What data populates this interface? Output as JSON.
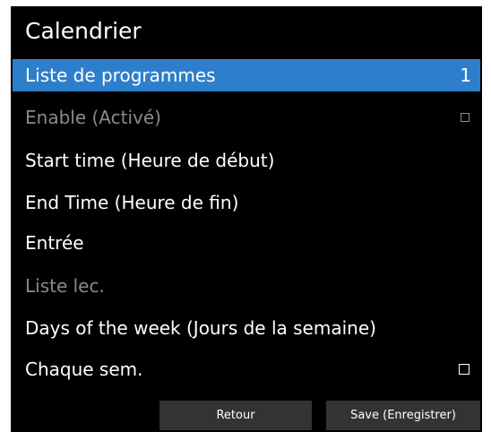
{
  "title": "Calendrier",
  "menu": {
    "items": [
      {
        "label": "Liste de programmes",
        "value": "1"
      },
      {
        "label": "Enable (Activé)",
        "checked": false
      },
      {
        "label": "Start time (Heure de début)"
      },
      {
        "label": "End Time (Heure de fin)"
      },
      {
        "label": "Entrée"
      },
      {
        "label": "Liste lec."
      },
      {
        "label": "Days of the week (Jours de la semaine)"
      },
      {
        "label": "Chaque sem.",
        "checked": false
      }
    ]
  },
  "footer": {
    "back_label": "Retour",
    "save_label": "Save (Enregistrer)"
  },
  "colors": {
    "background": "#000000",
    "selected": "#2e7fcb",
    "text": "#ffffff",
    "disabled_text": "#8a8a8a",
    "button": "#333333"
  },
  "icons": {
    "checkbox": "checkbox-icon"
  }
}
